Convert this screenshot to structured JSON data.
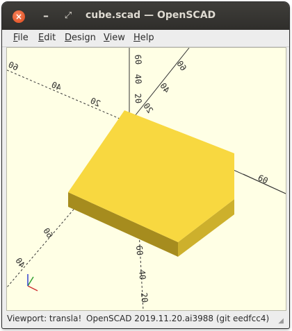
{
  "window": {
    "title": "cube.scad — OpenSCAD",
    "close_glyph": "×",
    "minimize_glyph": "–",
    "maximize_glyph": "⤢"
  },
  "menubar": {
    "items": [
      {
        "label": "File",
        "mnemonic": "F",
        "rest": "ile"
      },
      {
        "label": "Edit",
        "mnemonic": "E",
        "rest": "dit"
      },
      {
        "label": "Design",
        "mnemonic": "D",
        "rest": "esign"
      },
      {
        "label": "View",
        "mnemonic": "V",
        "rest": "iew"
      },
      {
        "label": "Help",
        "mnemonic": "H",
        "rest": "elp"
      }
    ]
  },
  "viewport": {
    "background": "#ffffe5",
    "cube_colors": {
      "top": "#f8d840",
      "left": "#a68c1e",
      "right": "#cdb02c"
    },
    "axis_tick_labels": {
      "neg_x": [
        "60",
        "40",
        "20"
      ],
      "pos_x": [
        "60"
      ],
      "pos_y": [
        "60",
        "40",
        "20"
      ],
      "pos_z": [
        "20",
        "40",
        "60"
      ],
      "neg_y": [
        "60",
        "40",
        "20"
      ]
    }
  },
  "statusbar": {
    "viewport_text": "Viewport: transla!",
    "version_text": "OpenSCAD 2019.11.20.ai3988 (git eedfcc4)"
  }
}
